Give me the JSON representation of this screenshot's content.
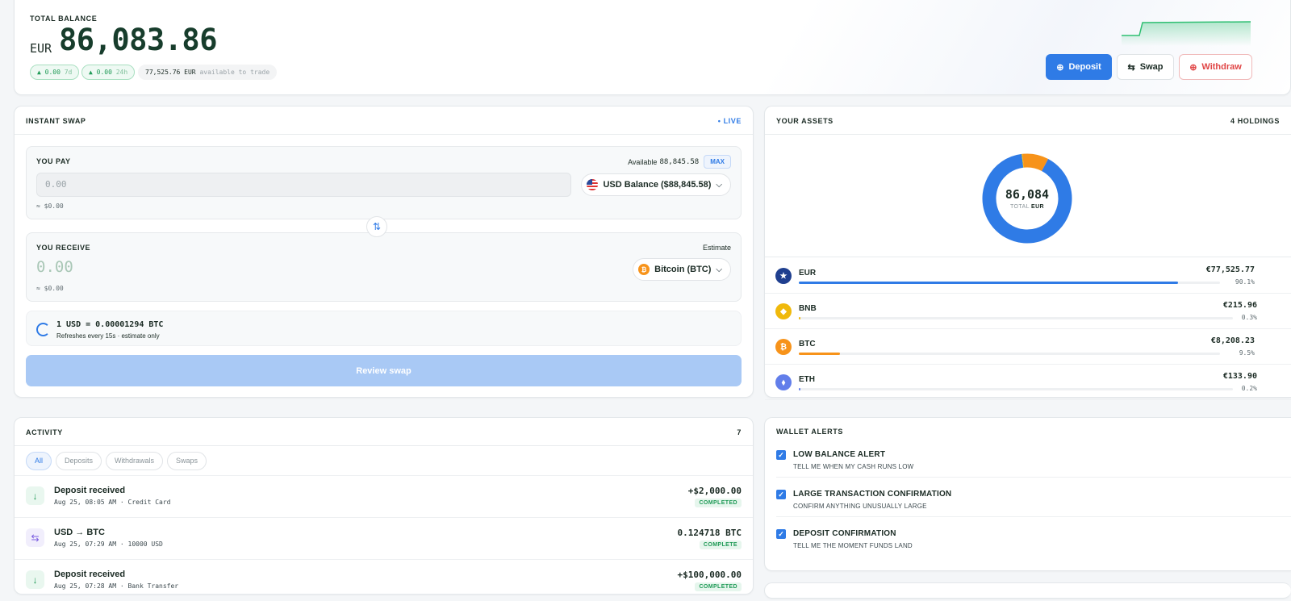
{
  "header": {
    "label": "TOTAL BALANCE",
    "currency": "EUR",
    "amount": "86,083.86",
    "change_7d": "▲ 0.00",
    "change_7d_period": "7d",
    "change_24h": "▲ 0.00",
    "change_24h_period": "24h",
    "available_amount": "77,525.76 EUR",
    "available_label": "available to trade",
    "buttons": {
      "deposit": "Deposit",
      "swap": "Swap",
      "withdraw": "Withdraw"
    }
  },
  "swap": {
    "title": "INSTANT SWAP",
    "live": "• LIVE",
    "pay": {
      "title": "YOU PAY",
      "available_label": "Available",
      "available_value": "88,845.58",
      "max": "MAX",
      "placeholder": "0.00",
      "usd_hint": "≈ $0.00",
      "asset": "USD Balance ($88,845.58)"
    },
    "receive": {
      "title": "YOU RECEIVE",
      "estimate": "Estimate",
      "amount": "0.00",
      "usd_hint": "≈ $0.00",
      "asset": "Bitcoin (BTC)"
    },
    "rate": "1 USD = 0.00001294 BTC",
    "rate_note": "Refreshes every 15s · estimate only",
    "review": "Review swap"
  },
  "assets": {
    "title": "YOUR ASSETS",
    "holdings": "4 HOLDINGS",
    "total_value": "86,084",
    "total_label": "TOTAL",
    "total_currency": "EUR",
    "items": [
      {
        "name": "EUR",
        "value": "€77,525.77",
        "pct": "90.1%",
        "share": 0.901,
        "color": "#2f7be6",
        "icon": "euro-stars-icon"
      },
      {
        "name": "BNB",
        "value": "€215.96",
        "pct": "0.3%",
        "share": 0.003,
        "color": "#f0b90b",
        "icon": "bnb-icon"
      },
      {
        "name": "BTC",
        "value": "€8,208.23",
        "pct": "9.5%",
        "share": 0.095,
        "color": "#f7931a",
        "icon": "bitcoin-icon"
      },
      {
        "name": "ETH",
        "value": "€133.90",
        "pct": "0.2%",
        "share": 0.002,
        "color": "#627eea",
        "icon": "ethereum-icon"
      }
    ]
  },
  "activity": {
    "title": "ACTIVITY",
    "count": "7",
    "tabs": [
      "All",
      "Deposits",
      "Withdrawals",
      "Swaps"
    ],
    "rows": [
      {
        "title": "Deposit received",
        "meta": "Aug 25, 08:05 AM · Credit Card",
        "amount": "+$2,000.00",
        "status": "COMPLETED",
        "kind": "deposit"
      },
      {
        "title": "USD → BTC",
        "meta": "Aug 25, 07:29 AM · 10000 USD",
        "amount": "0.124718 BTC",
        "status": "COMPLETE",
        "kind": "swap"
      },
      {
        "title": "Deposit received",
        "meta": "Aug 25, 07:28 AM · Bank Transfer",
        "amount": "+$100,000.00",
        "status": "COMPLETED",
        "kind": "deposit"
      }
    ]
  },
  "alerts": {
    "title": "WALLET ALERTS",
    "items": [
      {
        "title": "LOW BALANCE ALERT",
        "desc": "TELL ME WHEN MY CASH RUNS LOW"
      },
      {
        "title": "LARGE TRANSACTION CONFIRMATION",
        "desc": "CONFIRM ANYTHING UNUSUALLY LARGE"
      },
      {
        "title": "DEPOSIT CONFIRMATION",
        "desc": "TELL ME THE MOMENT FUNDS LAND"
      }
    ]
  }
}
